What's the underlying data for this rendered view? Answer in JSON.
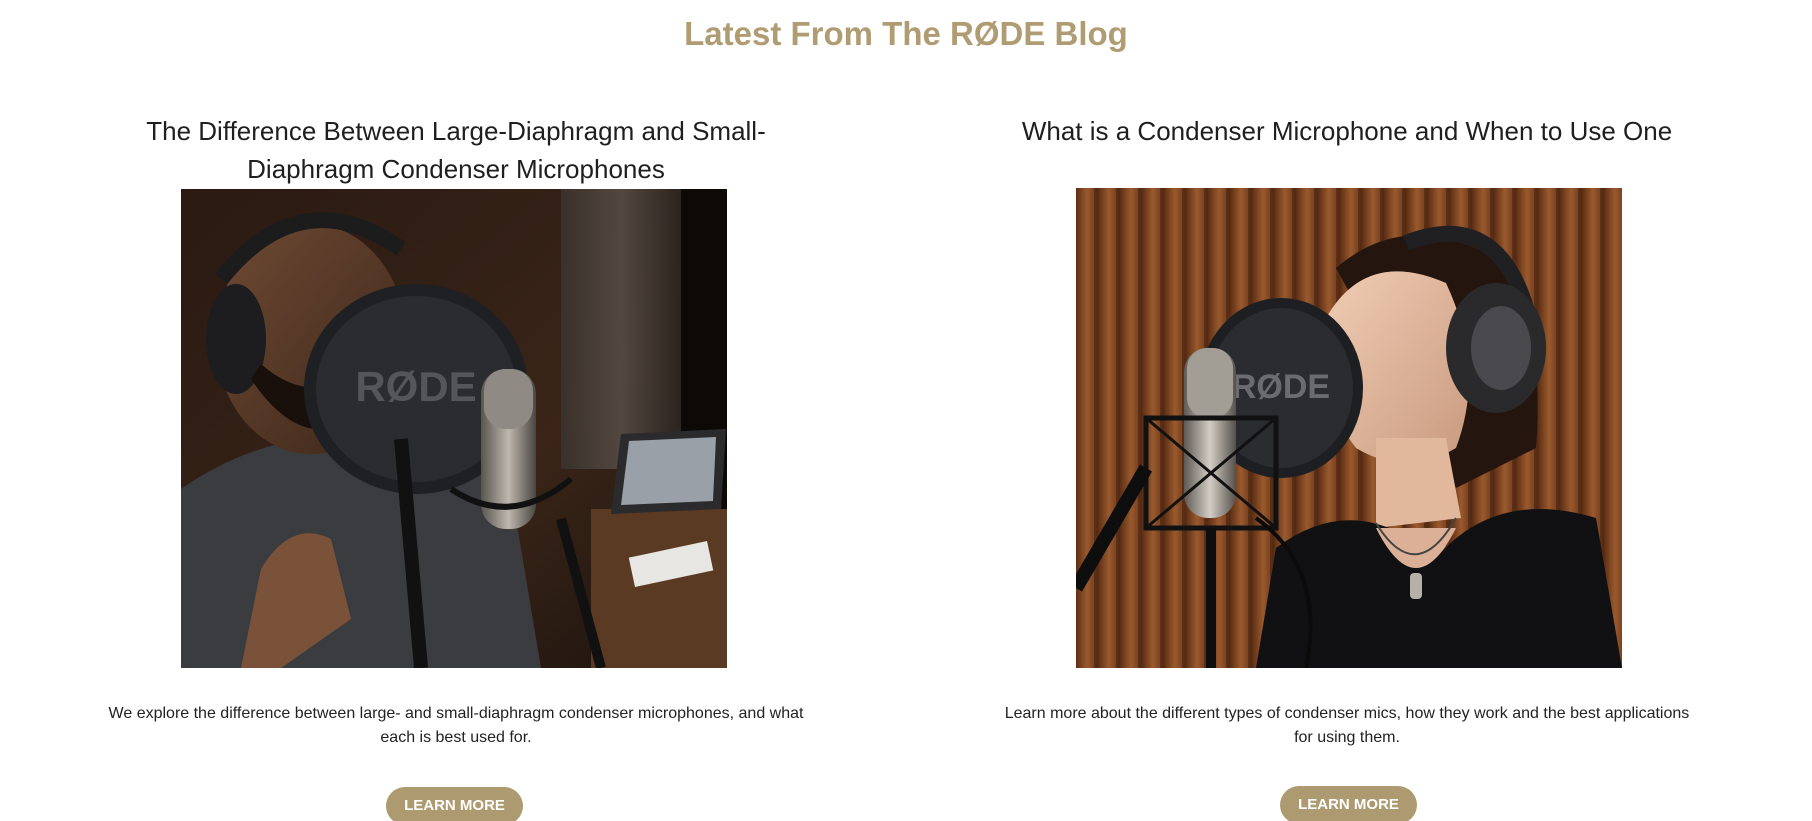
{
  "section": {
    "title": "Latest From The RØDE Blog"
  },
  "posts": [
    {
      "title": "The Difference Between Large-Diaphragm and Small-Diaphragm Condenser Microphones",
      "description": "We explore the difference between large- and small-diaphragm condenser microphones, and what each is best used for.",
      "button_label": "LEARN MORE",
      "image_brand_text": "RØDE"
    },
    {
      "title": "What is a Condenser Microphone and When to Use One",
      "description": "Learn more about the different types of condenser mics, how they work and the best applications for using them.",
      "button_label": "LEARN MORE",
      "image_brand_text": "RØDE"
    }
  ],
  "colors": {
    "accent": "#b09c72",
    "button": "#ad9a70"
  }
}
